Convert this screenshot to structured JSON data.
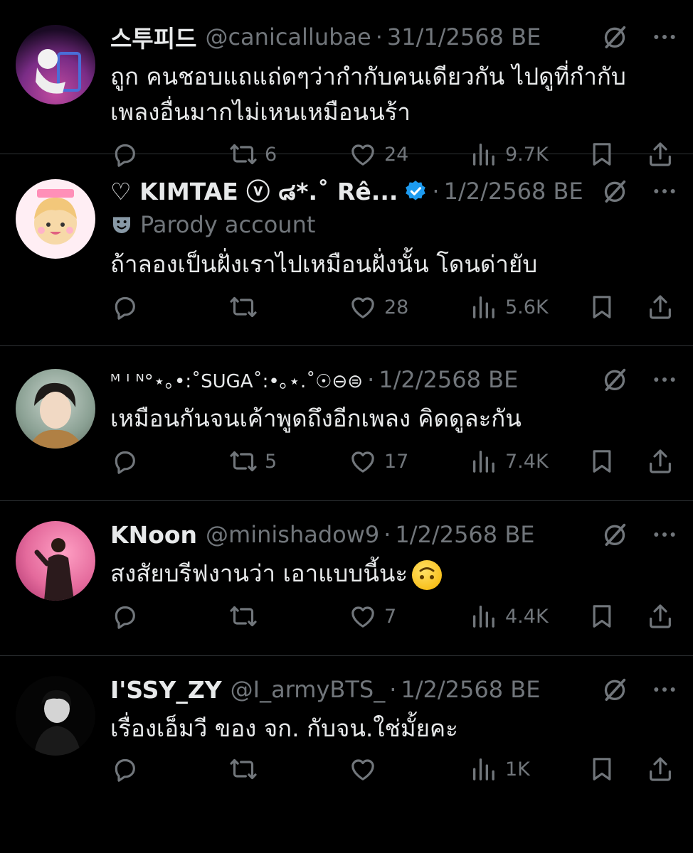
{
  "tweets": [
    {
      "name": "스투피드",
      "handle": "@canicallubae",
      "date": "31/1/2568 BE",
      "text_lines": [
        "ถูก คนชอบแถแถ่ดๆว่ากำกับคนเดียวกัน ไปดูที่กำกับ",
        "เพลงอื่นมากไม่เหนเหมือนนร้า"
      ],
      "replies": "",
      "retweets": "6",
      "likes": "24",
      "views": "9.7K"
    },
    {
      "name": "♡ KIMTAE ⓥ ๘*.˚ Rê...",
      "verified": true,
      "sub_label": "Parody account",
      "date": "1/2/2568 BE",
      "text_lines": [
        "ถ้าลองเป็นฝั่งเราไปเหมือนฝั่งนั้น โดนด่ายับ"
      ],
      "replies": "",
      "retweets": "",
      "likes": "28",
      "views": "5.6K"
    },
    {
      "name": "ᴹ ᴵ ᴺ°⋆｡•:˚SUGA˚:•｡⋆.˚☉⊖⊜",
      "date": "1/2/2568 BE",
      "text_lines": [
        "เหมือนกันจนเค้าพูดถึงอีกเพลง คิดดูละกัน"
      ],
      "replies": "",
      "retweets": "5",
      "likes": "17",
      "views": "7.4K"
    },
    {
      "name": "KNoon",
      "handle": "@minishadow9",
      "date": "1/2/2568 BE",
      "text_lines": [
        "สงสัยบรีฟงานว่า เอาแบบนี้นะ"
      ],
      "replies": "",
      "retweets": "",
      "likes": "7",
      "views": "4.4K"
    },
    {
      "name": "I'SSY_ZY",
      "handle": "@I_armyBTS_",
      "date": "1/2/2568 BE",
      "text_lines": [
        "เรื่องเอ็มวี ของ จก. กับจน.ใช่มั้ยคะ"
      ],
      "replies": "",
      "retweets": "",
      "likes": "",
      "views": "1K"
    }
  ],
  "icons": {
    "reply": "speech-bubble-icon",
    "retweet": "retweet-icon",
    "like": "heart-icon",
    "views": "bar-chart-icon",
    "bookmark": "bookmark-icon",
    "share": "share-icon",
    "grok": "grok-icon",
    "more": "more-dots-icon",
    "parody": "theater-mask-icon",
    "emoji": "upside-down-face-emoji"
  },
  "colors": {
    "background": "#000000",
    "text": "#e7e9ea",
    "muted": "#71767b",
    "verified": "#1d9bf0",
    "divider": "#2f3336"
  }
}
